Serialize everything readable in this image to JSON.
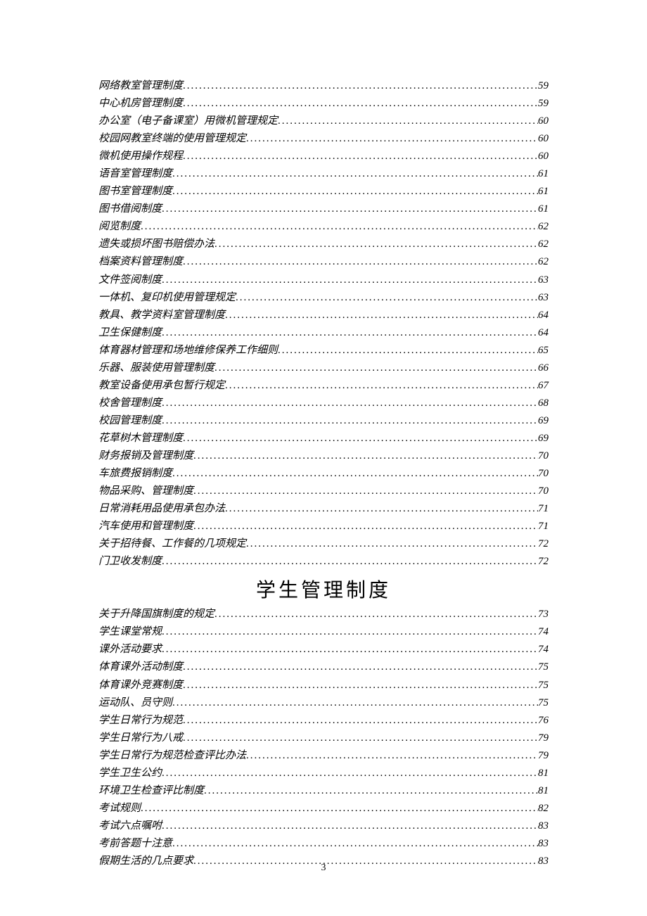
{
  "sections": [
    {
      "heading": null,
      "entries": [
        {
          "title": "网络教室管理制度",
          "page": "59"
        },
        {
          "title": "中心机房管理制度",
          "page": "59"
        },
        {
          "title": "办公室（电子备课室）用微机管理规定",
          "page": "60"
        },
        {
          "title": "校园网教室终端的使用管理规定",
          "page": "60"
        },
        {
          "title": "微机使用操作规程",
          "page": "60"
        },
        {
          "title": "语音室管理制度",
          "page": "61"
        },
        {
          "title": "图书室管理制度",
          "page": "61"
        },
        {
          "title": "图书借阅制度",
          "page": "61"
        },
        {
          "title": "阅览制度",
          "page": "62"
        },
        {
          "title": "遗失或损坏图书赔偿办法",
          "page": "62"
        },
        {
          "title": "档案资料管理制度",
          "page": "62"
        },
        {
          "title": "文件签阅制度",
          "page": "63"
        },
        {
          "title": "一体机、复印机使用管理规定",
          "page": "63"
        },
        {
          "title": "教具、教学资料室管理制度",
          "page": "64"
        },
        {
          "title": "卫生保健制度",
          "page": "64"
        },
        {
          "title": "体育器材管理和场地维修保养工作细则",
          "page": "65"
        },
        {
          "title": "乐器、服装使用管理制度",
          "page": "66"
        },
        {
          "title": "教室设备使用承包暂行规定",
          "page": "67"
        },
        {
          "title": "校舍管理制度",
          "page": "68"
        },
        {
          "title": "校园管理制度",
          "page": "69"
        },
        {
          "title": "花草树木管理制度",
          "page": "69"
        },
        {
          "title": "财务报销及管理制度",
          "page": "70"
        },
        {
          "title": "车旅费报销制度",
          "page": "70"
        },
        {
          "title": "物品采购、管理制度",
          "page": "70"
        },
        {
          "title": "日常消耗用品使用承包办法",
          "page": "71"
        },
        {
          "title": "汽车使用和管理制度",
          "page": "71"
        },
        {
          "title": "关于招待餐、工作餐的几项规定",
          "page": "72"
        },
        {
          "title": "门卫收发制度",
          "page": "72"
        }
      ]
    },
    {
      "heading": "学生管理制度",
      "entries": [
        {
          "title": "关于升降国旗制度的规定",
          "page": "73"
        },
        {
          "title": "学生课堂常规",
          "page": "74"
        },
        {
          "title": "课外活动要求",
          "page": "74"
        },
        {
          "title": "体育课外活动制度",
          "page": "75"
        },
        {
          "title": "体育课外竞赛制度",
          "page": "75"
        },
        {
          "title": "运动队、员守则",
          "page": "75"
        },
        {
          "title": "学生日常行为规范",
          "page": "76"
        },
        {
          "title": "学生日常行为八戒",
          "page": "79"
        },
        {
          "title": "学生日常行为规范检查评比办法",
          "page": "79"
        },
        {
          "title": "学生卫生公约",
          "page": "81"
        },
        {
          "title": "环境卫生检查评比制度",
          "page": "81"
        },
        {
          "title": "考试规则",
          "page": "82"
        },
        {
          "title": "考试六点嘱咐",
          "page": "83"
        },
        {
          "title": "考前答题十注意",
          "page": "83"
        },
        {
          "title": "假期生活的几点要求",
          "page": "83"
        }
      ]
    }
  ],
  "pageNumber": "3"
}
